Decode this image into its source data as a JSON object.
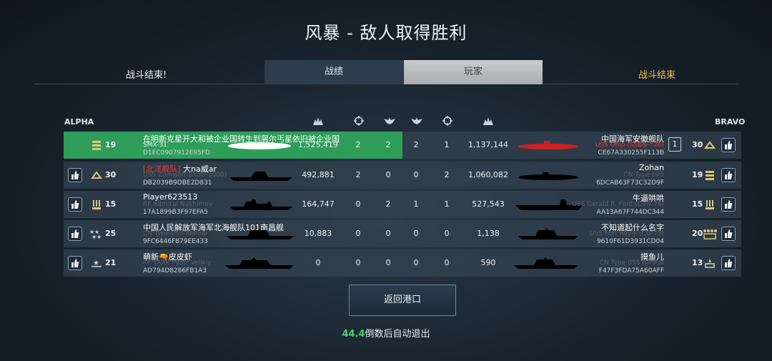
{
  "title": "风暴 - 敌人取得胜利",
  "tabs": {
    "left_status": "战斗结束!",
    "stats": "战绩",
    "players": "玩家",
    "right_status": "战斗结束"
  },
  "teams": {
    "left": "ALPHA",
    "right": "BRAVO"
  },
  "columns": [
    "damage-icon",
    "crosshair-icon",
    "eagle-icon",
    "eagle-icon",
    "crosshair-icon",
    "damage-icon"
  ],
  "rows": [
    {
      "left": {
        "rank": "19",
        "name": "在明斯克星开大和被企业国转生到屑尔丐星依旧被企业国",
        "ship": "SMX-31",
        "id": "D1EC0907912E95FD"
      },
      "stats": [
        "1,525,419",
        "2",
        "2",
        "2",
        "1",
        "1,137,144"
      ],
      "right": {
        "name": "中国海军安徽舰队",
        "ship": "USS Ohio (SSBN-726)",
        "id": "CE67A330255F113B",
        "rank": "30",
        "badge": "1"
      }
    },
    {
      "left": {
        "rank": "30",
        "tag": "[北洋舰队]",
        "name": "大na威ar",
        "ship": "USS Zumwalt (DDG-1000)",
        "id": "DB2039B9DBE2D831"
      },
      "stats": [
        "492,881",
        "2",
        "0",
        "0",
        "2",
        "1,060,082"
      ],
      "right": {
        "name": "Zohan",
        "ship": "CN Type 095",
        "id": "6DCAB63F73C32D9F",
        "rank": "19"
      }
    },
    {
      "left": {
        "rank": "15",
        "name": "Player623513",
        "ship": "RF Admiral Nakhimov",
        "id": "17A1899B3F97EFA5"
      },
      "stats": [
        "164,747",
        "0",
        "2",
        "1",
        "1",
        "527,543"
      ],
      "right": {
        "name": "牛逼哄哄",
        "ship": "USS Gerald R. Ford (CVN-78)",
        "id": "AA13A67F744DC344",
        "rank": "15"
      }
    },
    {
      "left": {
        "rank": "25",
        "name": "中国人民解放军海军北海舰队101南昌舰",
        "ship": "CN Type 055 Renhai",
        "id": "9FC6446F879EE433"
      },
      "stats": [
        "10,883",
        "0",
        "0",
        "0",
        "0",
        "1,138"
      ],
      "right": {
        "name": "不知道起什么名字",
        "ship": "USS Port Royal (CG-73)",
        "id": "9610F61D3931CD04",
        "rank": "20"
      }
    },
    {
      "left": {
        "rank": "21",
        "name": "萌新🔫皮皮虾",
        "ship": "RF TARK Pyotr Velikiy",
        "id": "AD794D8286FB1A3"
      },
      "stats": [
        "0",
        "0",
        "0",
        "0",
        "0",
        "590"
      ],
      "right": {
        "name": "摸鱼儿",
        "ship": "CN Type 055 Renhai",
        "id": "F47F3FDA75A60AFF",
        "rank": "13"
      }
    }
  ],
  "return_button": "返回港口",
  "countdown": {
    "value": "44.4",
    "text": "倒数后自动退出"
  }
}
